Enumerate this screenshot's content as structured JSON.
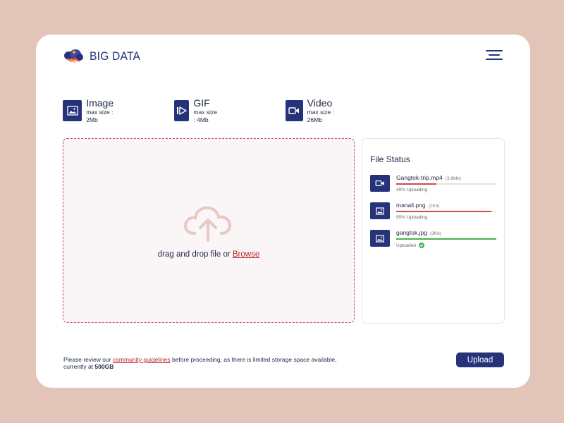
{
  "brand": {
    "name": "BIG DATA"
  },
  "colors": {
    "background": "#e3c4b9",
    "accent": "#26337a",
    "progress": "#d24a4a",
    "complete": "#4caf50",
    "link": "#b52a2a"
  },
  "file_types": [
    {
      "icon": "image-icon",
      "name": "Image",
      "max_size": "max size : 2Mb"
    },
    {
      "icon": "gif-play-icon",
      "name": "GIF",
      "max_size": "max size : 4Mb"
    },
    {
      "icon": "video-camera-icon",
      "name": "Video",
      "max_size": "max size : 26Mb"
    }
  ],
  "dropzone": {
    "text": "drag and drop file or ",
    "browse": "Browse",
    "icon": "cloud-upload-icon"
  },
  "file_status": {
    "title": "File Status",
    "files": [
      {
        "name": "Gangtok-trip.mp4",
        "size": "(3.8Mb)",
        "progress": 0.4,
        "state": "40% Uploading",
        "icon": "video-camera-icon"
      },
      {
        "name": "manali.png",
        "size": "(2Kb)",
        "progress": 0.95,
        "state": "95% Uploading",
        "icon": "image-icon"
      },
      {
        "name": "gangtok.jpg",
        "size": "(3Kb)",
        "progress": 1.0,
        "state": "Uploaded",
        "icon": "image-icon"
      }
    ]
  },
  "notice": {
    "before": "Please review our ",
    "link": "community guidelines",
    "after": " before proceeding, as there is limited storage space available, currently at ",
    "storage": "500GB"
  },
  "upload_button": "Upload"
}
